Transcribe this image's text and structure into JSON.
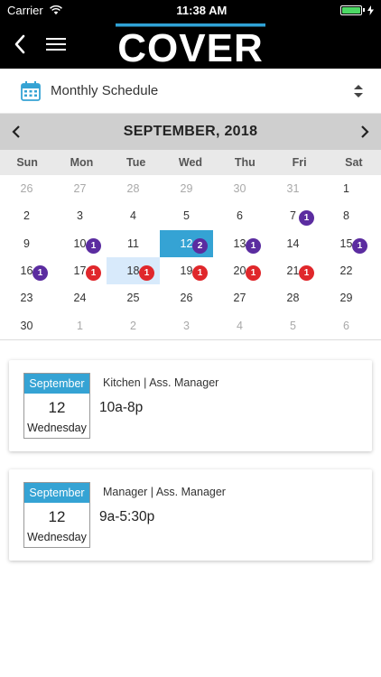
{
  "status_bar": {
    "carrier": "Carrier",
    "time": "11:38 AM"
  },
  "header": {
    "logo_text": "COVER"
  },
  "view_selector": {
    "label": "Monthly Schedule"
  },
  "calendar": {
    "title": "SEPTEMBER, 2018",
    "weekdays": [
      "Sun",
      "Mon",
      "Tue",
      "Wed",
      "Thu",
      "Fri",
      "Sat"
    ],
    "weeks": [
      [
        {
          "d": "26",
          "m": true
        },
        {
          "d": "27",
          "m": true
        },
        {
          "d": "28",
          "m": true
        },
        {
          "d": "29",
          "m": true
        },
        {
          "d": "30",
          "m": true
        },
        {
          "d": "31",
          "m": true
        },
        {
          "d": "1"
        }
      ],
      [
        {
          "d": "2"
        },
        {
          "d": "3"
        },
        {
          "d": "4"
        },
        {
          "d": "5"
        },
        {
          "d": "6"
        },
        {
          "d": "7",
          "b": "1",
          "c": "purple"
        },
        {
          "d": "8"
        }
      ],
      [
        {
          "d": "9"
        },
        {
          "d": "10",
          "b": "1",
          "c": "purple"
        },
        {
          "d": "11"
        },
        {
          "d": "12",
          "b": "2",
          "c": "purple",
          "sel": true
        },
        {
          "d": "13",
          "b": "1",
          "c": "purple"
        },
        {
          "d": "14"
        },
        {
          "d": "15",
          "b": "1",
          "c": "purple"
        }
      ],
      [
        {
          "d": "16",
          "b": "1",
          "c": "purple"
        },
        {
          "d": "17",
          "b": "1",
          "c": "red"
        },
        {
          "d": "18",
          "b": "1",
          "c": "red",
          "today": true
        },
        {
          "d": "19",
          "b": "1",
          "c": "red"
        },
        {
          "d": "20",
          "b": "1",
          "c": "red"
        },
        {
          "d": "21",
          "b": "1",
          "c": "red"
        },
        {
          "d": "22"
        }
      ],
      [
        {
          "d": "23"
        },
        {
          "d": "24"
        },
        {
          "d": "25"
        },
        {
          "d": "26"
        },
        {
          "d": "27"
        },
        {
          "d": "28"
        },
        {
          "d": "29"
        }
      ],
      [
        {
          "d": "30"
        },
        {
          "d": "1",
          "m": true
        },
        {
          "d": "2",
          "m": true
        },
        {
          "d": "3",
          "m": true
        },
        {
          "d": "4",
          "m": true
        },
        {
          "d": "5",
          "m": true
        },
        {
          "d": "6",
          "m": true
        }
      ]
    ]
  },
  "shifts": [
    {
      "month": "September",
      "day": "12",
      "weekday": "Wednesday",
      "role": "Kitchen | Ass. Manager",
      "time": "10a-8p"
    },
    {
      "month": "September",
      "day": "12",
      "weekday": "Wednesday",
      "role": "Manager | Ass. Manager",
      "time": "9a-5:30p"
    }
  ],
  "colors": {
    "accent": "#35a3d4",
    "badge_purple": "#5b2ca0",
    "badge_red": "#e0272b",
    "header_bg": "#000000"
  }
}
